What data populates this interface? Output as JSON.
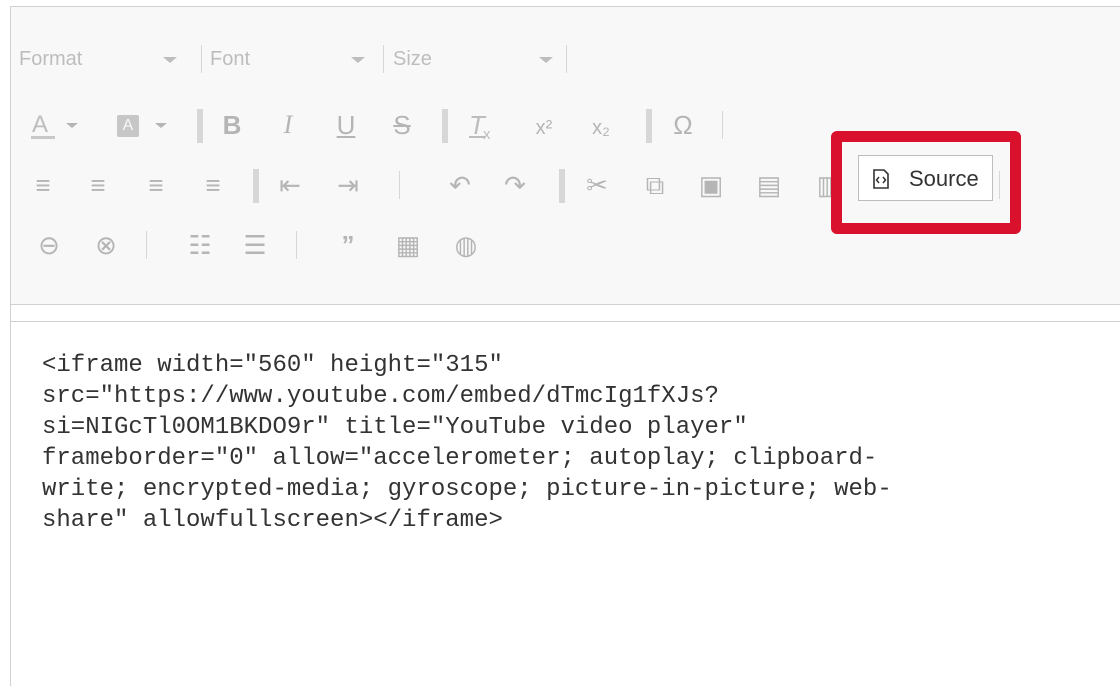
{
  "toolbar": {
    "format_label": "Format",
    "font_label": "Font",
    "size_label": "Size",
    "bold_label": "B",
    "italic_label": "I",
    "underline_label": "U",
    "strikethrough_label": "S",
    "source_label": "Source",
    "special_char_label": "Ω",
    "superscript_label": "x²",
    "subscript_label": "x₂"
  },
  "editor": {
    "source_text": "<iframe width=\"560\" height=\"315\"\nsrc=\"https://www.youtube.com/embed/dTmcIg1fXJs?\nsi=NIGcTl0OM1BKDO9r\" title=\"YouTube video player\"\nframeborder=\"0\" allow=\"accelerometer; autoplay; clipboard-\nwrite; encrypted-media; gyroscope; picture-in-picture; web-\nshare\" allowfullscreen></iframe>"
  },
  "colors": {
    "highlight": "#d9112d",
    "toolbar_background": "#f8f8f8",
    "icon_gray": "#b5b5b5"
  },
  "icons": [
    "text-color-icon",
    "background-color-icon",
    "bold-icon",
    "italic-icon",
    "underline-icon",
    "strikethrough-icon",
    "remove-format-icon",
    "superscript-icon",
    "subscript-icon",
    "special-character-icon",
    "align-left-icon",
    "align-center-icon",
    "align-right-icon",
    "justify-icon",
    "decrease-indent-icon",
    "increase-indent-icon",
    "undo-icon",
    "redo-icon",
    "cut-icon",
    "copy-icon",
    "paste-from-word-icon",
    "paste-icon",
    "paste-as-text-icon",
    "source-icon",
    "link-icon",
    "unlink-icon",
    "bulleted-list-icon",
    "numbered-list-icon",
    "blockquote-icon",
    "image-icon",
    "globe-icon"
  ]
}
